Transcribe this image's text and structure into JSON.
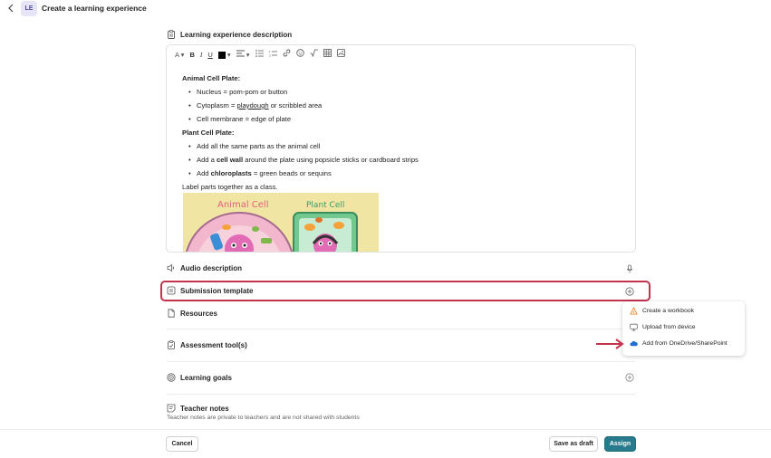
{
  "header": {
    "back_icon": "chevron-left-icon",
    "avatar_initials": "LE",
    "title": "Create a learning experience"
  },
  "description": {
    "heading": "Learning experience description",
    "toolbar": {
      "font_size": "A",
      "bold": "B",
      "italic": "I",
      "underline": "U",
      "text_color": "#000000"
    },
    "content": {
      "animal_heading": "Animal Cell Plate:",
      "animal_items": [
        "Nucleus = pom-pom or button",
        [
          "Cytoplasm = ",
          "playdough",
          " or scribbled area"
        ],
        "Cell membrane = edge of plate"
      ],
      "plant_heading": "Plant Cell Plate:",
      "plant_items": [
        "Add all the same parts as the animal cell",
        [
          "Add a ",
          "cell wall",
          " around the plate using popsicle sticks or cardboard strips"
        ],
        [
          "Add ",
          "chloroplasts",
          " = green beads or sequins"
        ]
      ],
      "footer_line": "Label parts together as a class.",
      "image_label_left": "Animal Cell",
      "image_label_right": "Plant Cell"
    }
  },
  "sections": {
    "audio": "Audio description",
    "submission": "Submission template",
    "resources": "Resources",
    "assessment": "Assessment tool(s)",
    "goals": "Learning goals",
    "teacher_notes": "Teacher notes",
    "teacher_notes_hint": "Teacher notes are private to teachers and are not shared with students"
  },
  "popup_menu": {
    "items": [
      {
        "label": "Create a workbook",
        "icon": "workbook-icon"
      },
      {
        "label": "Upload from device",
        "icon": "monitor-icon"
      },
      {
        "label": "Add from OneDrive/SharePoint",
        "icon": "cloud-icon"
      }
    ]
  },
  "footer": {
    "cancel": "Cancel",
    "save_draft": "Save as draft",
    "assign": "Assign"
  },
  "colors": {
    "accent": "#277b8c",
    "highlight": "#c2334e",
    "avatar_bg": "#e6e4f7"
  }
}
